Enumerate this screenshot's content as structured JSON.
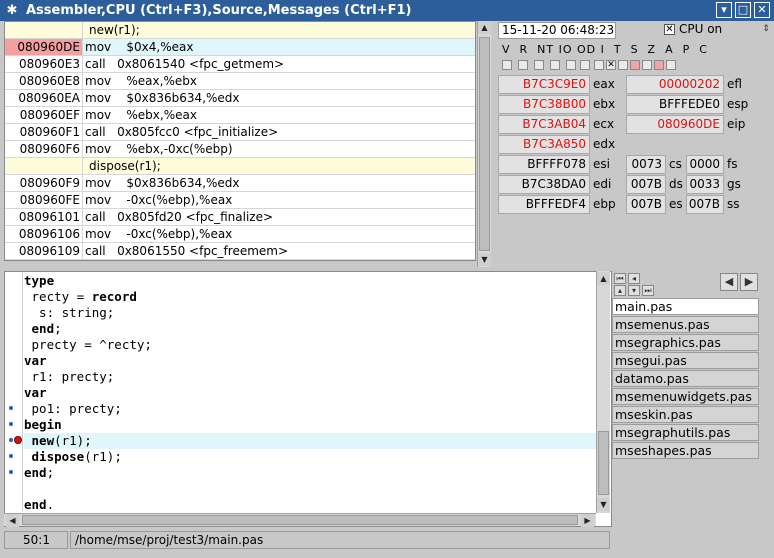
{
  "window": {
    "title": "Assembler,CPU (Ctrl+F3),Source,Messages (Ctrl+F1)"
  },
  "assembler": {
    "rows": [
      {
        "type": "src",
        "addr": "",
        "text": "new(r1);"
      },
      {
        "type": "cur",
        "addr": "080960DE",
        "text": "mov    $0x4,%eax"
      },
      {
        "type": "ins",
        "addr": "080960E3",
        "text": "call   0x8061540 <fpc_getmem>"
      },
      {
        "type": "ins",
        "addr": "080960E8",
        "text": "mov    %eax,%ebx"
      },
      {
        "type": "ins",
        "addr": "080960EA",
        "text": "mov    $0x836b634,%edx"
      },
      {
        "type": "ins",
        "addr": "080960EF",
        "text": "mov    %ebx,%eax"
      },
      {
        "type": "ins",
        "addr": "080960F1",
        "text": "call   0x805fcc0 <fpc_initialize>"
      },
      {
        "type": "ins",
        "addr": "080960F6",
        "text": "mov    %ebx,-0xc(%ebp)"
      },
      {
        "type": "src",
        "addr": "",
        "text": "dispose(r1);"
      },
      {
        "type": "ins",
        "addr": "080960F9",
        "text": "mov    $0x836b634,%edx"
      },
      {
        "type": "ins",
        "addr": "080960FE",
        "text": "mov    -0xc(%ebp),%eax"
      },
      {
        "type": "ins",
        "addr": "08096101",
        "text": "call   0x805fd20 <fpc_finalize>"
      },
      {
        "type": "ins",
        "addr": "08096106",
        "text": "mov    -0xc(%ebp),%eax"
      },
      {
        "type": "ins",
        "addr": "08096109",
        "text": "call   0x8061550 <fpc_freemem>"
      }
    ]
  },
  "cpu": {
    "timestamp": "15-11-20 06:48:23",
    "cpu_on_label": "CPU on",
    "cpu_on_checked": true,
    "flags_label": "V  R  NT IO OD I  T  S  Z  A  P  C",
    "registers": {
      "eax": "B7C3C9E0",
      "ebx": "B7C38B00",
      "ecx": "B7C3AB04",
      "edx": "B7C3A850",
      "esi": "BFFFF078",
      "edi": "B7C38DA0",
      "ebp": "BFFFEDF4",
      "efl": "00000202",
      "esp": "BFFFEDE0",
      "eip": "080960DE",
      "cs": "0073",
      "ds": "007B",
      "es": "007B",
      "fs": "0000",
      "gs": "0033",
      "ss": "007B"
    },
    "labels": {
      "eax": "eax",
      "ebx": "ebx",
      "ecx": "ecx",
      "edx": "edx",
      "esi": "esi",
      "edi": "edi",
      "ebp": "ebp",
      "efl": "efl",
      "esp": "esp",
      "eip": "eip",
      "cs": "cs",
      "ds": "ds",
      "es": "es",
      "fs": "fs",
      "gs": "gs",
      "ss": "ss"
    }
  },
  "source": {
    "l1": "type",
    "l2a": " recty = ",
    "l2b": "record",
    "l3": "  s: string;",
    "l4a": " ",
    "l4b": "end",
    "l4c": ";",
    "l5": " precty = ^recty;",
    "l6": "var",
    "l7": " r1: precty;",
    "l8": "var",
    "l9": " po1: precty;",
    "l10": "begin",
    "l11a": " ",
    "l11b": "new",
    "l11c": "(r1);",
    "l12a": " ",
    "l12b": "dispose",
    "l12c": "(r1);",
    "l13a": "end",
    "l13b": ";",
    "l15a": "end",
    "l15b": "."
  },
  "files": {
    "tabs": [
      "main.pas",
      "msemenus.pas",
      "msegraphics.pas",
      "msegui.pas",
      "datamo.pas",
      "msemenuwidgets.pas",
      "mseskin.pas",
      "msegraphutils.pas",
      "mseshapes.pas"
    ]
  },
  "status": {
    "position": "50:1",
    "path": "/home/mse/proj/test3/main.pas"
  }
}
